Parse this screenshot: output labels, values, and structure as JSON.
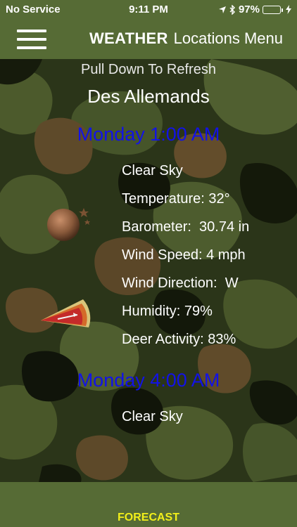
{
  "status_bar": {
    "carrier": "No Service",
    "time": "9:11 PM",
    "battery": "97%",
    "battery_level": 0.97,
    "icons": [
      "location-arrow-icon",
      "bluetooth-icon",
      "battery-icon",
      "charging-bolt-icon"
    ]
  },
  "nav": {
    "menu_icon": "hamburger-menu-icon",
    "title_bold": "WEATHER",
    "title_rest": "Locations Menu"
  },
  "content": {
    "refresh_hint": "Pull Down To Refresh",
    "location": "Des Allemands",
    "forecasts": [
      {
        "time": "Monday 1:00 AM",
        "condition": "Clear Sky",
        "temperature": "Temperature: 32°",
        "barometer": "Barometer:  30.74 in",
        "wind_speed": "Wind Speed: 4 mph",
        "wind_direction": "Wind Direction:  W",
        "humidity": "Humidity: 79%",
        "deer_activity": "Deer Activity: 83%",
        "moon_icon": "moon-phase-icon",
        "wind_icon": "wind-direction-icon"
      },
      {
        "time": "Monday 4:00 AM",
        "condition": "Clear Sky"
      }
    ]
  },
  "tab_bar": {
    "forecast_label": "FORECAST"
  },
  "colors": {
    "bar_green": "#566b35",
    "time_blue": "#1212e8",
    "tab_yellow": "#f2ef1a"
  }
}
